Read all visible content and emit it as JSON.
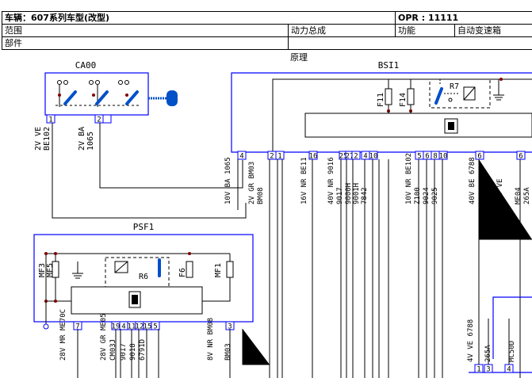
{
  "header": {
    "vehicle": "车辆：607系列车型(改型)",
    "opr": "OPR : 11111",
    "scope_label": "范围",
    "scope_value": "动力总成",
    "function_label": "功能",
    "function_value": "自动变速箱",
    "part_label": "部件",
    "principle_label": "原理"
  },
  "diagram": {
    "ca00": {
      "title": "CA00",
      "pins": [
        "1",
        "2"
      ],
      "wires": [
        {
          "gauge": "2V",
          "color": "VE",
          "code": "BE102"
        },
        {
          "gauge": "2V",
          "color": "BA",
          "code": "1065"
        }
      ]
    },
    "bsi1": {
      "title": "BSI1",
      "fuses": [
        "F11",
        "F14"
      ],
      "relay": "R7",
      "pins": [
        "4",
        "2",
        "1",
        "16",
        "25",
        "27",
        "2",
        "4",
        "10",
        "5",
        "6",
        "8",
        "10",
        "6",
        "6"
      ],
      "wires": [
        {
          "gauge": "10V",
          "color": "BA",
          "code": "1065"
        },
        {
          "gauge": "2V",
          "color": "GR",
          "code": "BM03"
        },
        {
          "code": "BM08"
        },
        {
          "gauge": "16V",
          "color": "NR",
          "code": "BE11"
        },
        {
          "gauge": "40V",
          "color": "NR",
          "code": "9016"
        },
        {
          "code": "9017"
        },
        {
          "code": "9000H"
        },
        {
          "code": "9001H"
        },
        {
          "code": "7842"
        },
        {
          "gauge": "10V",
          "color": "NR",
          "code": "BE102"
        },
        {
          "code": "Z100"
        },
        {
          "code": "9024"
        },
        {
          "code": "9025"
        },
        {
          "gauge": "40V",
          "color": "BE",
          "code": "6788"
        },
        {
          "gauge": "16V",
          "color": "VE"
        },
        {
          "code": "ME04"
        },
        {
          "code": "265A"
        }
      ]
    },
    "psf1": {
      "title": "PSF1",
      "fuses": [
        "MF3",
        "MF5",
        "F6",
        "MF1"
      ],
      "relay": "R6",
      "pins": [
        "7",
        "19",
        "4",
        "11",
        "12",
        "15",
        "5",
        "3"
      ],
      "wires": [
        {
          "gauge": "28V",
          "color": "MR",
          "code": "ME70C"
        },
        {
          "gauge": "28V",
          "color": "GR",
          "code": "ME05"
        },
        {
          "code": "CM03J"
        },
        {
          "code": "9017"
        },
        {
          "code": "9018"
        },
        {
          "code": "6791D"
        },
        {
          "gauge": "8V",
          "color": "NR",
          "code": "BM08"
        },
        {
          "code": "BM03"
        }
      ]
    },
    "lower_right": {
      "pins": [
        "1",
        "3",
        "4"
      ],
      "wires": [
        {
          "gauge": "4V",
          "color": "VE",
          "code": "6788"
        },
        {
          "code": "265A"
        },
        {
          "code": "MC50D"
        }
      ]
    },
    "colors": {
      "box": "#0000ff",
      "wire": "#000000",
      "junction": "#800000",
      "component": "#0050c8"
    }
  }
}
